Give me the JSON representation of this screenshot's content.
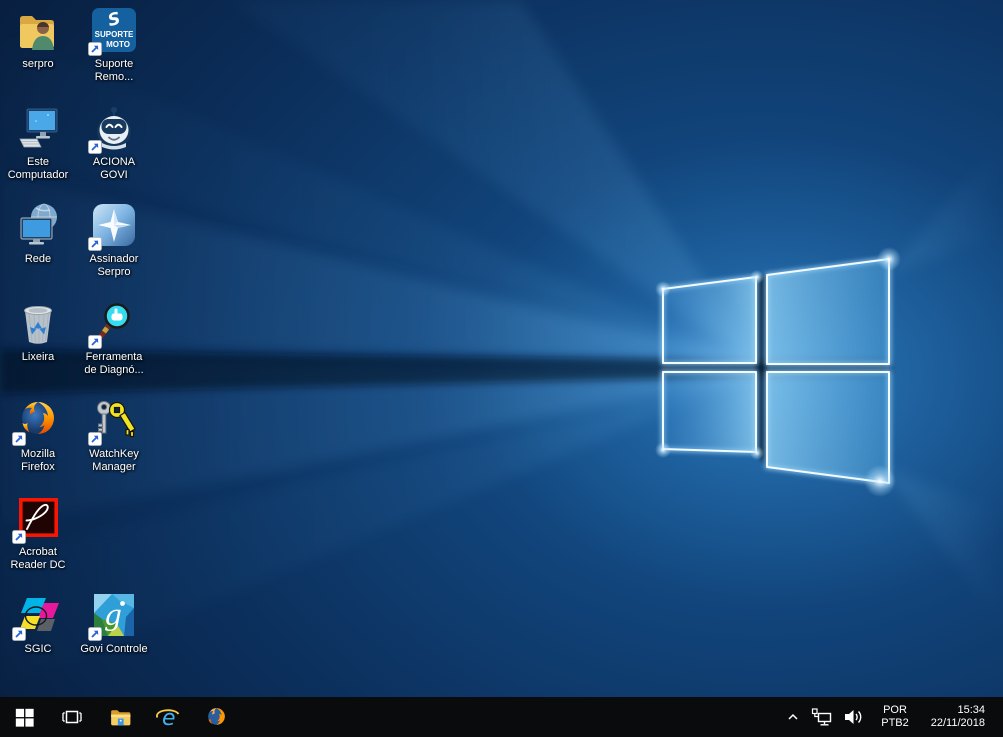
{
  "desktop": {
    "icons": [
      {
        "name": "serpro",
        "label": "serpro"
      },
      {
        "name": "suporte-remoto",
        "label_line1": "Suporte",
        "label_line2": "Remo...",
        "icon_text_top": "SUPORTE",
        "icon_text_bottom": "MOTO"
      },
      {
        "name": "este-computador",
        "label_line1": "Este",
        "label_line2": "Computador"
      },
      {
        "name": "aciona-govi",
        "label_line1": "ACIONA",
        "label_line2": "GOVI"
      },
      {
        "name": "rede",
        "label": "Rede"
      },
      {
        "name": "assinador-serpro",
        "label_line1": "Assinador",
        "label_line2": "Serpro"
      },
      {
        "name": "lixeira",
        "label": "Lixeira"
      },
      {
        "name": "ferramenta-de-diagnostico",
        "label_line1": "Ferramenta",
        "label_line2": "de Diagnó..."
      },
      {
        "name": "mozilla-firefox",
        "label_line1": "Mozilla",
        "label_line2": "Firefox"
      },
      {
        "name": "watchkey-manager",
        "label_line1": "WatchKey",
        "label_line2": "Manager"
      },
      {
        "name": "acrobat-reader-dc",
        "label_line1": "Acrobat",
        "label_line2": "Reader DC"
      },
      {
        "name": "sgic",
        "label": "SGIC"
      },
      {
        "name": "govi-controle",
        "label": "Govi Controle",
        "icon_letter": "g"
      }
    ]
  },
  "taskbar": {
    "buttons": [
      "start",
      "task-view",
      "file-explorer",
      "internet-explorer",
      "firefox"
    ],
    "tray": {
      "language_line1": "POR",
      "language_line2": "PTB2",
      "time": "15:34",
      "date": "22/11/2018"
    }
  },
  "colors": {
    "taskbar_bg": "#0a0b0d",
    "wallpaper_base": "#081f40",
    "wallpaper_accent": "#2e86d1",
    "shortcut_arrow_blue": "#2a62d8"
  }
}
